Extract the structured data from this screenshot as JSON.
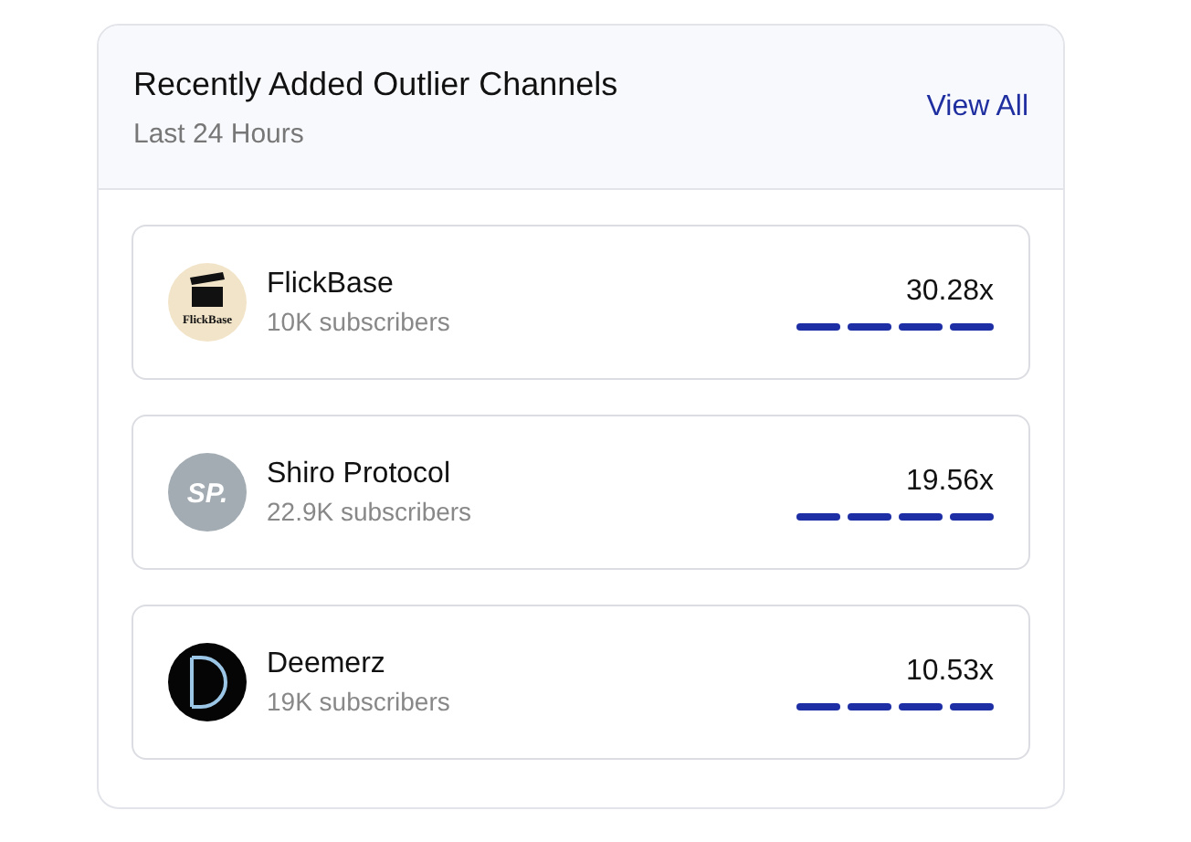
{
  "header": {
    "title": "Recently Added Outlier Channels",
    "subtitle": "Last 24 Hours",
    "link": "View All"
  },
  "channels": [
    {
      "name": "FlickBase",
      "subscribers": "10K subscribers",
      "score": "30.28x",
      "avatar": {
        "kind": "clapper",
        "text": "FlickBase"
      }
    },
    {
      "name": "Shiro Protocol",
      "subscribers": "22.9K subscribers",
      "score": "19.56x",
      "avatar": {
        "kind": "initials",
        "text": "SP."
      }
    },
    {
      "name": "Deemerz",
      "subscribers": "19K subscribers",
      "score": "10.53x",
      "avatar": {
        "kind": "letter-d"
      }
    }
  ]
}
